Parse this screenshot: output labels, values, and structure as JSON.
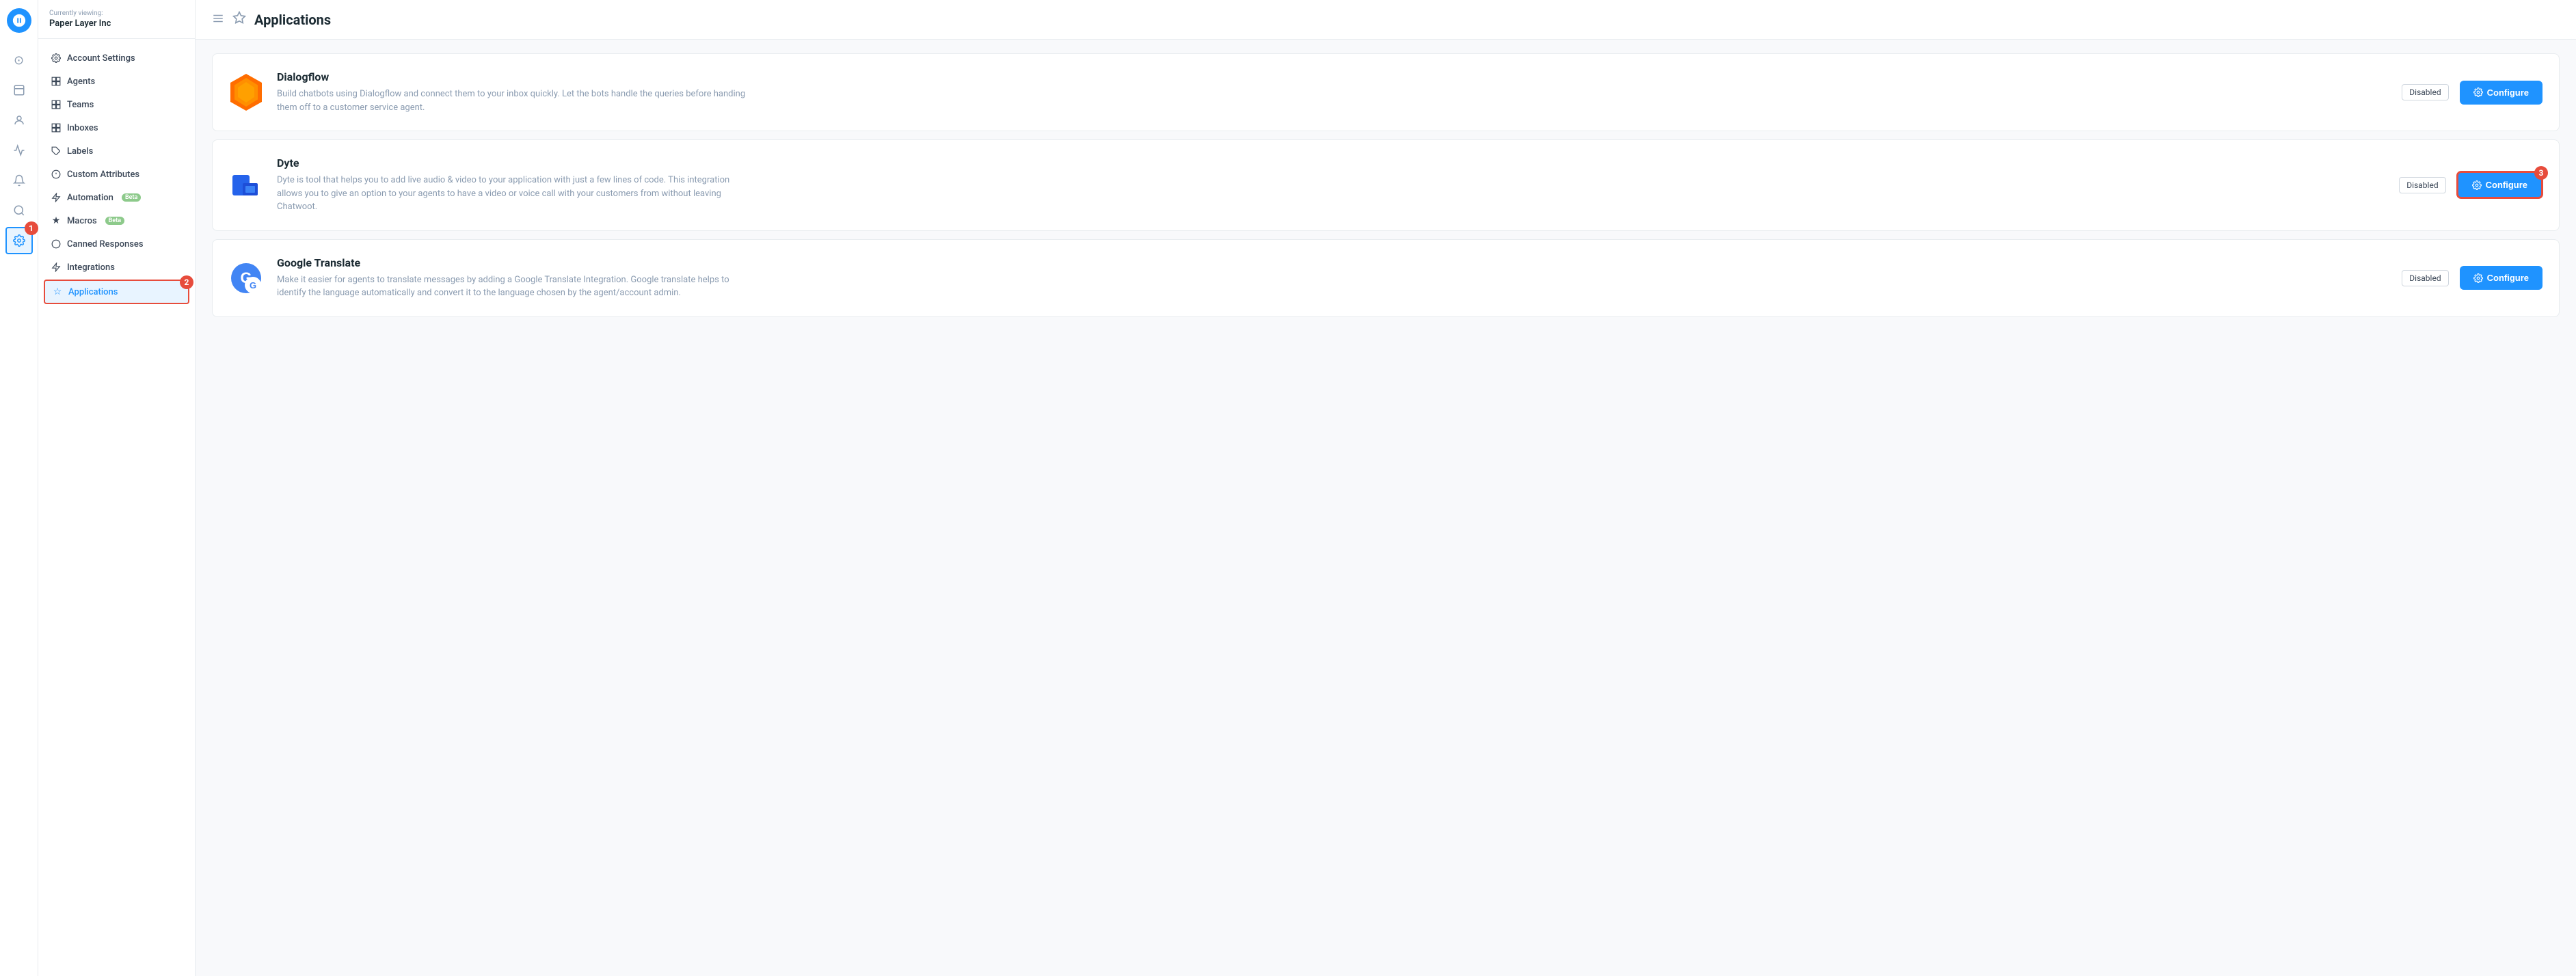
{
  "app": {
    "logo_alt": "Chatwoot logo"
  },
  "sidebar_header": {
    "currently_viewing": "Currently viewing:",
    "company_name": "Paper Layer Inc"
  },
  "sidebar_nav": {
    "items": [
      {
        "id": "account-settings",
        "icon": "⊙",
        "label": "Account Settings",
        "active": false,
        "badge": null
      },
      {
        "id": "agents",
        "icon": "⊞",
        "label": "Agents",
        "active": false,
        "badge": null
      },
      {
        "id": "teams",
        "icon": "⊞",
        "label": "Teams",
        "active": false,
        "badge": null
      },
      {
        "id": "inboxes",
        "icon": "⊞",
        "label": "Inboxes",
        "active": false,
        "badge": null
      },
      {
        "id": "labels",
        "icon": "○",
        "label": "Labels",
        "active": false,
        "badge": null
      },
      {
        "id": "custom-attributes",
        "icon": "⊙",
        "label": "Custom Attributes",
        "active": false,
        "badge": null
      },
      {
        "id": "automation",
        "icon": "⚡",
        "label": "Automation",
        "active": false,
        "badge": "Beta"
      },
      {
        "id": "macros",
        "icon": "★",
        "label": "Macros",
        "active": false,
        "badge": "Beta"
      },
      {
        "id": "canned-responses",
        "icon": "○",
        "label": "Canned Responses",
        "active": false,
        "badge": null
      },
      {
        "id": "integrations",
        "icon": "⚡",
        "label": "Integrations",
        "active": false,
        "badge": null
      },
      {
        "id": "applications",
        "icon": "☆",
        "label": "Applications",
        "active": true,
        "badge": null
      }
    ]
  },
  "icon_bar": {
    "icons": [
      {
        "id": "home",
        "symbol": "⊙"
      },
      {
        "id": "inbox",
        "symbol": "◻"
      },
      {
        "id": "contacts",
        "symbol": "◉"
      },
      {
        "id": "reports",
        "symbol": "📊"
      },
      {
        "id": "notifications",
        "symbol": "◎"
      },
      {
        "id": "search",
        "symbol": "⊟"
      },
      {
        "id": "settings",
        "symbol": "⚙",
        "active": true
      }
    ]
  },
  "header": {
    "title": "Applications",
    "hamburger_label": "menu",
    "star_label": "favorite"
  },
  "applications": [
    {
      "id": "dialogflow",
      "name": "Dialogflow",
      "description": "Build chatbots using Dialogflow and connect them to your inbox quickly. Let the bots handle the queries before handing them off to a customer service agent.",
      "status": "Disabled",
      "configure_label": "Configure",
      "highlighted": false
    },
    {
      "id": "dyte",
      "name": "Dyte",
      "description": "Dyte is tool that helps you to add live audio & video to your application with just a few lines of code. This integration allows you to give an option to your agents to have a video or voice call with your customers from without leaving Chatwoot.",
      "status": "Disabled",
      "configure_label": "Configure",
      "highlighted": true
    },
    {
      "id": "google-translate",
      "name": "Google Translate",
      "description": "Make it easier for agents to translate messages by adding a Google Translate Integration. Google translate helps to identify the language automatically and convert it to the language chosen by the agent/account admin.",
      "status": "Disabled",
      "configure_label": "Configure",
      "highlighted": false
    }
  ],
  "annotations": {
    "settings_icon": "1",
    "applications_nav": "2",
    "configure_dyte": "3"
  }
}
